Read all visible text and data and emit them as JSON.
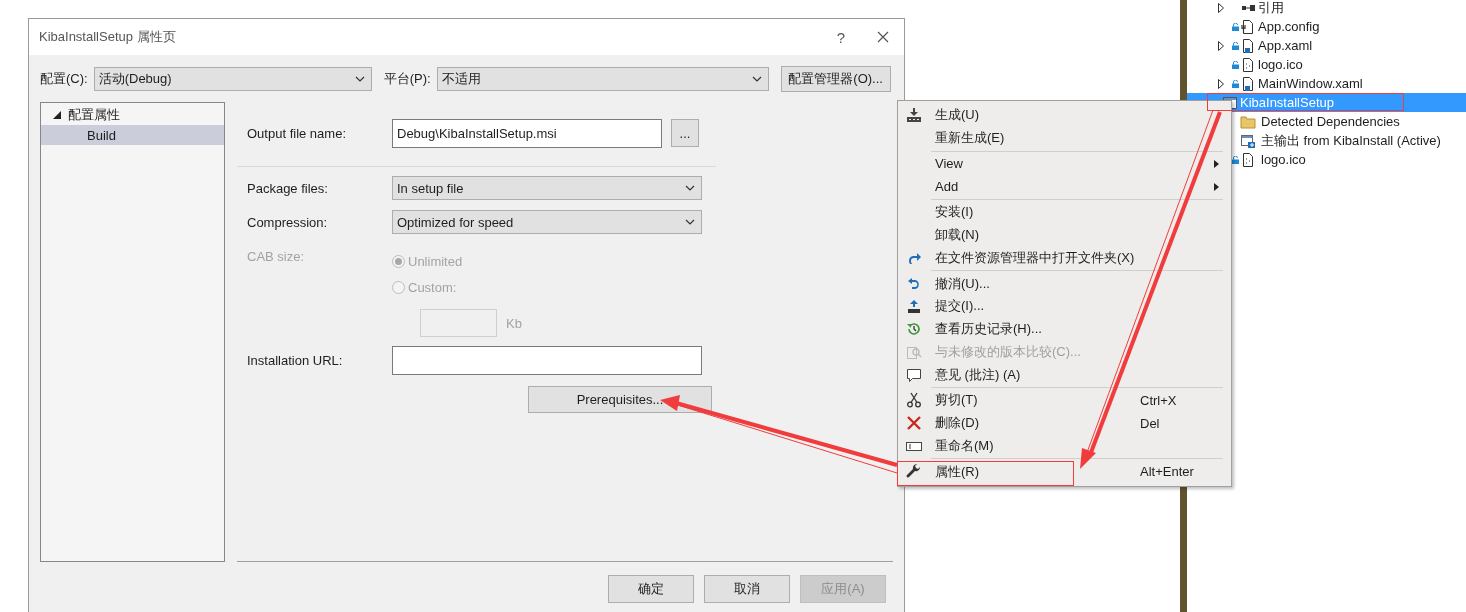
{
  "dialog": {
    "title": "KibaInstallSetup 属性页",
    "help": "?",
    "config": {
      "label": "配置(C):",
      "value": "活动(Debug)"
    },
    "platform": {
      "label": "平台(P):",
      "value": "不适用"
    },
    "config_manager_button": "配置管理器(O)...",
    "tree": [
      {
        "label": "配置属性",
        "expanded": true,
        "selected": false,
        "children": [
          {
            "label": "Build",
            "selected": true
          }
        ]
      }
    ],
    "output_file": {
      "label": "Output file name:",
      "value": "Debug\\KibaInstallSetup.msi",
      "browse_button": "..."
    },
    "package_files": {
      "label": "Package files:",
      "value": "In setup file"
    },
    "compression": {
      "label": "Compression:",
      "value": "Optimized for speed"
    },
    "cab_size": {
      "label": "CAB size:",
      "disabled": true,
      "options": [
        {
          "label": "Unlimited",
          "selected": true
        },
        {
          "label": "Custom:",
          "selected": false
        }
      ],
      "unit": "Kb"
    },
    "installation_url": {
      "label": "Installation URL:"
    },
    "prerequisites_button": "Prerequisites...",
    "buttons": [
      {
        "label": "确定",
        "disabled": false
      },
      {
        "label": "取消",
        "disabled": false
      },
      {
        "label": "应用(A)",
        "disabled": true
      }
    ]
  },
  "context_menu": {
    "groups": [
      [
        {
          "label": "生成(U)",
          "disabled": false,
          "submenu": false
        },
        {
          "label": "重新生成(E)",
          "disabled": false,
          "submenu": false
        }
      ],
      [
        {
          "label": "View",
          "disabled": false,
          "submenu": true
        },
        {
          "label": "Add",
          "disabled": false,
          "submenu": true
        }
      ],
      [
        {
          "label": "安装(I)",
          "disabled": false,
          "submenu": false
        },
        {
          "label": "卸载(N)",
          "disabled": false,
          "submenu": false
        },
        {
          "label": "在文件资源管理器中打开文件夹(X)",
          "disabled": false,
          "submenu": false
        }
      ],
      [
        {
          "label": "撤消(U)...",
          "disabled": false,
          "submenu": false
        },
        {
          "label": "提交(I)...",
          "disabled": false,
          "submenu": false
        },
        {
          "label": "查看历史记录(H)...",
          "disabled": false,
          "submenu": false
        },
        {
          "label": "与未修改的版本比较(C)...",
          "disabled": true,
          "submenu": false
        },
        {
          "label": "意见 (批注) (A)",
          "disabled": false,
          "submenu": false
        }
      ],
      [
        {
          "label": "剪切(T)",
          "shortcut": "Ctrl+X",
          "disabled": false,
          "submenu": false
        },
        {
          "label": "删除(D)",
          "shortcut": "Del",
          "disabled": false,
          "submenu": false
        },
        {
          "label": "重命名(M)",
          "disabled": false,
          "submenu": false
        }
      ],
      [
        {
          "label": "属性(R)",
          "shortcut": "Alt+Enter",
          "disabled": false,
          "submenu": false
        }
      ]
    ]
  },
  "solution_explorer": {
    "upper_items": [
      {
        "label": "引用",
        "expanded": false,
        "checked_in": false
      },
      {
        "label": "App.config",
        "checked_in": true
      },
      {
        "label": "App.xaml",
        "expanded": false,
        "checked_in": true
      },
      {
        "label": "logo.ico",
        "checked_in": true
      },
      {
        "label": "MainWindow.xaml",
        "expanded": false,
        "checked_in": true
      }
    ],
    "project": {
      "label": "KibaInstallSetup",
      "selected": true,
      "children": [
        {
          "label": "Detected Dependencies",
          "checked_in": false
        },
        {
          "label": "主输出 from KibaInstall (Active)",
          "checked_in": false
        },
        {
          "label": "logo.ico",
          "checked_in": true
        }
      ]
    }
  }
}
